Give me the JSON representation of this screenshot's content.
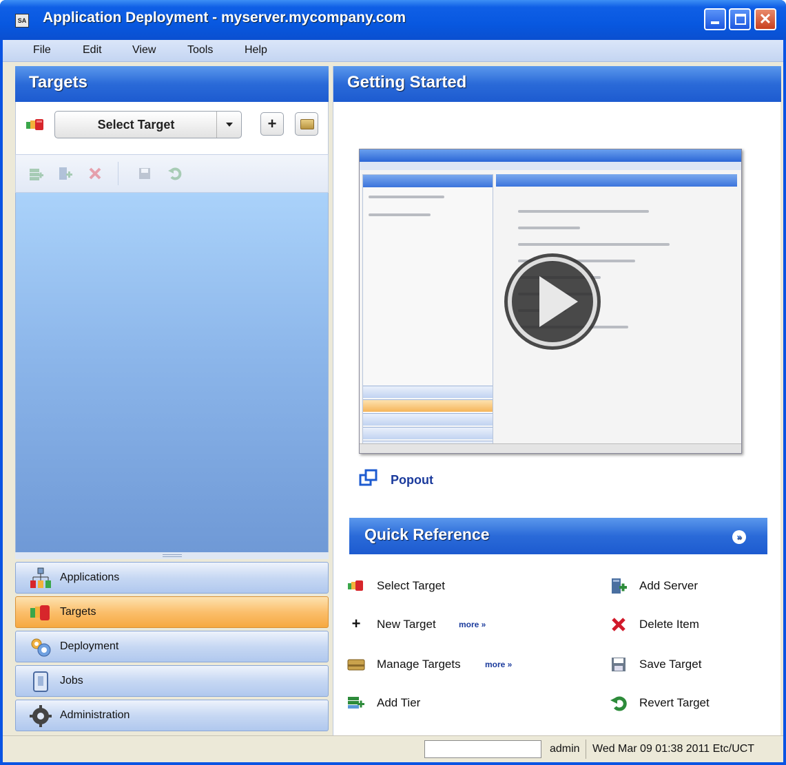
{
  "window": {
    "title": "Application Deployment - myserver.mycompany.com",
    "app_icon": "SA"
  },
  "menu": [
    "File",
    "Edit",
    "View",
    "Tools",
    "Help"
  ],
  "left_panel": {
    "header": "Targets",
    "select_target_label": "Select Target",
    "action_icons": [
      "add-tier-icon",
      "add-server-icon",
      "delete-icon",
      "save-icon",
      "revert-icon"
    ],
    "nav": [
      {
        "label": "Applications",
        "icon": "applications-icon",
        "active": false
      },
      {
        "label": "Targets",
        "icon": "targets-icon",
        "active": true
      },
      {
        "label": "Deployment",
        "icon": "deployment-icon",
        "active": false
      },
      {
        "label": "Jobs",
        "icon": "jobs-icon",
        "active": false
      },
      {
        "label": "Administration",
        "icon": "administration-icon",
        "active": false
      }
    ]
  },
  "right_panel": {
    "header": "Getting Started",
    "popout_label": "Popout",
    "quick_reference": {
      "title": "Quick Reference",
      "left_items": [
        {
          "label": "Select Target",
          "icon": "select-target-icon",
          "more": ""
        },
        {
          "label": "New Target",
          "icon": "plus-icon",
          "more": "more »"
        },
        {
          "label": "Manage Targets",
          "icon": "manage-targets-icon",
          "more": "more »"
        },
        {
          "label": "Add Tier",
          "icon": "add-tier-icon",
          "more": ""
        }
      ],
      "right_items": [
        {
          "label": "Add Server",
          "icon": "add-server-icon"
        },
        {
          "label": "Delete Item",
          "icon": "delete-icon"
        },
        {
          "label": "Save Target",
          "icon": "save-icon"
        },
        {
          "label": "Revert Target",
          "icon": "revert-icon"
        }
      ]
    }
  },
  "status": {
    "user": "admin",
    "datetime": "Wed Mar 09 01:38 2011 Etc/UCT"
  },
  "colors": {
    "title_bar": "#0a54e3",
    "panel_header": "#2a6ad8",
    "active_nav": "#fbbf6c",
    "link": "#1a3a9c"
  }
}
